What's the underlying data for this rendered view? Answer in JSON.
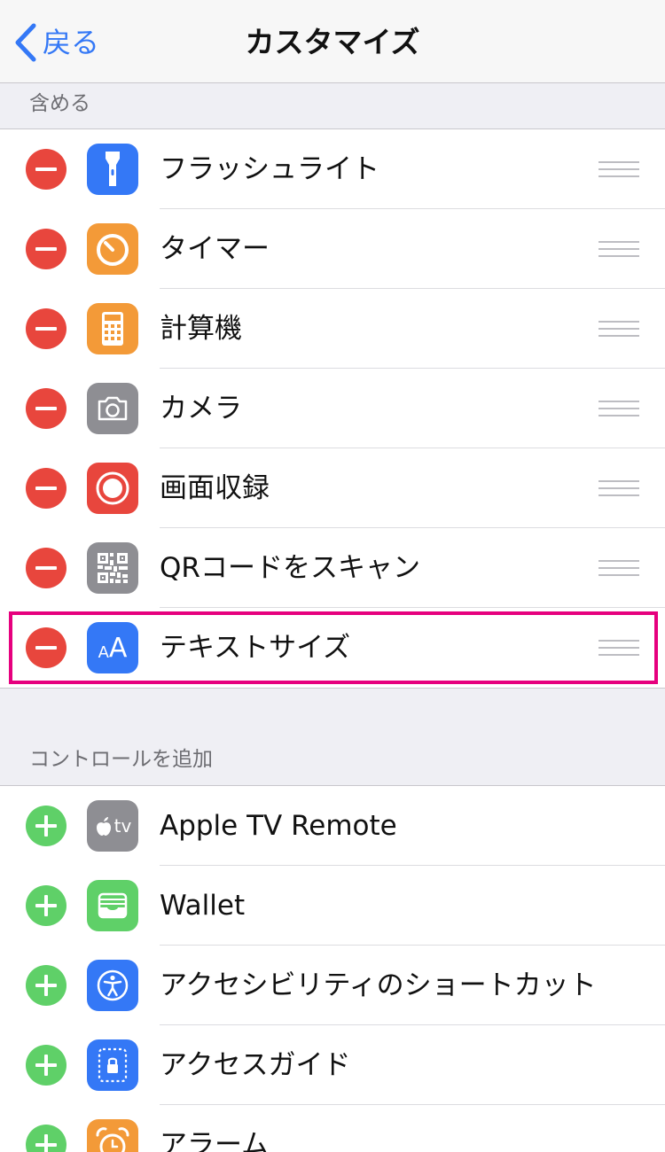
{
  "navbar": {
    "back_label": "戻る",
    "title": "カスタマイズ"
  },
  "include_section": {
    "header": "含める",
    "items": [
      {
        "label": "フラッシュライト",
        "icon": "flashlight-icon",
        "icon_color": "#3478f6"
      },
      {
        "label": "タイマー",
        "icon": "timer-icon",
        "icon_color": "#f39a38"
      },
      {
        "label": "計算機",
        "icon": "calculator-icon",
        "icon_color": "#f39a38"
      },
      {
        "label": "カメラ",
        "icon": "camera-icon",
        "icon_color": "#8e8e93"
      },
      {
        "label": "画面収録",
        "icon": "screen-record-icon",
        "icon_color": "#e8463d"
      },
      {
        "label": "QRコードをスキャン",
        "icon": "qr-code-icon",
        "icon_color": "#8e8e93"
      },
      {
        "label": "テキストサイズ",
        "icon": "text-size-icon",
        "icon_color": "#3478f6",
        "highlighted": true,
        "icon_text_small": "A",
        "icon_text_large": "A"
      }
    ]
  },
  "add_section": {
    "header": "コントロールを追加",
    "items": [
      {
        "label": "Apple TV Remote",
        "icon": "apple-tv-icon",
        "icon_color": "#8e8e93",
        "icon_text": "tv"
      },
      {
        "label": "Wallet",
        "icon": "wallet-icon",
        "icon_color": "#5fd068"
      },
      {
        "label": "アクセシビリティのショートカット",
        "icon": "accessibility-icon",
        "icon_color": "#3478f6"
      },
      {
        "label": "アクセスガイド",
        "icon": "guided-access-icon",
        "icon_color": "#3478f6"
      },
      {
        "label": "アラーム",
        "icon": "alarm-icon",
        "icon_color": "#f39a38"
      }
    ]
  },
  "colors": {
    "accent": "#3478f6",
    "remove": "#e8463d",
    "add": "#5fd068",
    "highlight": "#e6007e"
  }
}
